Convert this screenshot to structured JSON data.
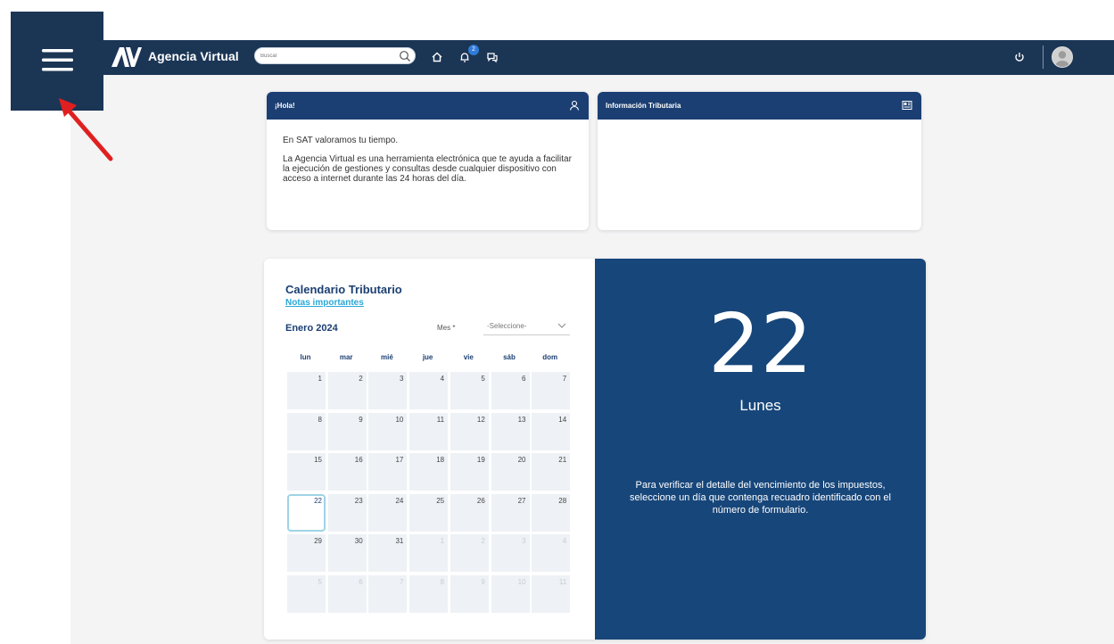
{
  "app": {
    "title": "Agencia Virtual",
    "logo": "AV"
  },
  "search": {
    "placeholder": "Buscar"
  },
  "notifications": {
    "count": "2"
  },
  "hola_card": {
    "title": "¡Hola!",
    "line1": "En SAT valoramos tu tiempo.",
    "line2": "La Agencia Virtual es una herramienta electrónica que te ayuda a facilitar la ejecución de gestiones y consultas desde cualquier dispositivo con acceso a internet durante las 24 horas del día."
  },
  "info_card": {
    "title": "Información Tributaria"
  },
  "calendar": {
    "title": "Calendario Tributario",
    "notes_link": "Notas importantes",
    "month_label": "Enero 2024",
    "mes_label": "Mes *",
    "mes_select": "-Seleccione-",
    "weekdays": [
      "lun",
      "mar",
      "mié",
      "jue",
      "vie",
      "sáb",
      "dom"
    ],
    "weeks": [
      [
        "1",
        "2",
        "3",
        "4",
        "5",
        "6",
        "7"
      ],
      [
        "8",
        "9",
        "10",
        "11",
        "12",
        "13",
        "14"
      ],
      [
        "15",
        "16",
        "17",
        "18",
        "19",
        "20",
        "21"
      ],
      [
        "22",
        "23",
        "24",
        "25",
        "26",
        "27",
        "28"
      ],
      [
        "29",
        "30",
        "31",
        "1",
        "2",
        "3",
        "4"
      ],
      [
        "5",
        "6",
        "7",
        "8",
        "9",
        "10",
        "11"
      ]
    ],
    "selected_day": "22"
  },
  "day_panel": {
    "day": "22",
    "weekday": "Lunes",
    "info": "Para verificar el detalle del vencimiento de los impuestos, seleccione un día que contenga recuadro identificado con el número de formulario."
  },
  "colors": {
    "navy": "#1b3555",
    "panel": "#17467a",
    "accent": "#2aa8d8",
    "arrow": "#e02020"
  }
}
